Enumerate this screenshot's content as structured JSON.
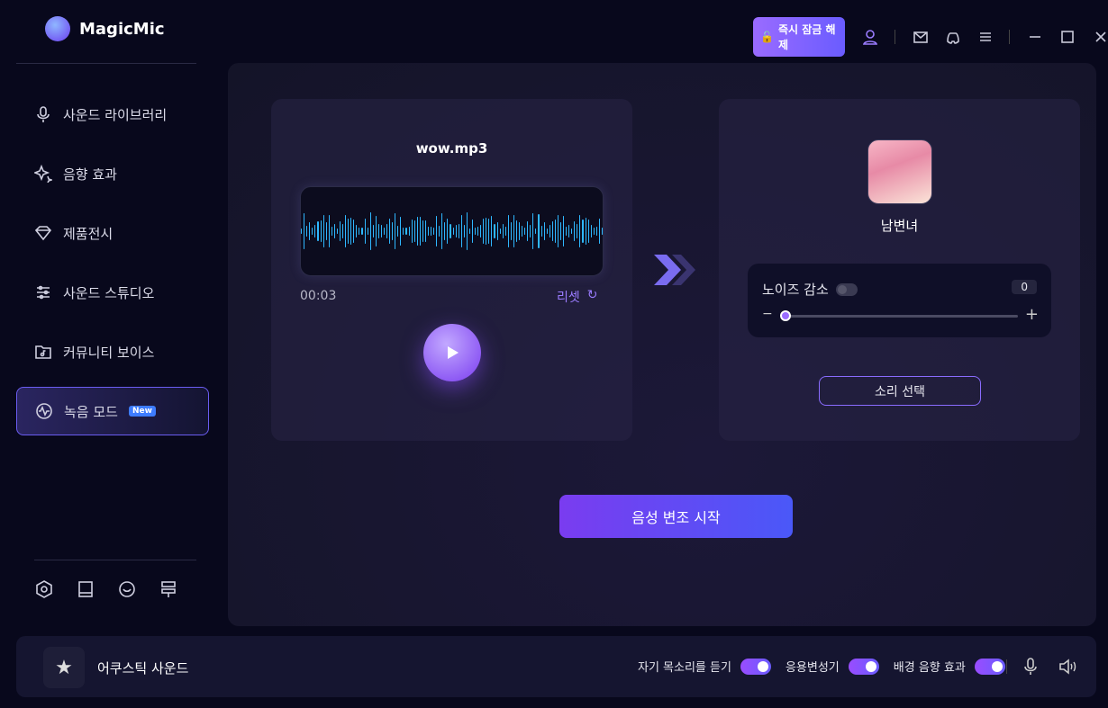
{
  "app": {
    "title": "MagicMic"
  },
  "topbar": {
    "unlock_label": "즉시 잠금 해제"
  },
  "sidebar": {
    "items": [
      {
        "label": "사운드 라이브러리",
        "icon": "microphone-icon"
      },
      {
        "label": "음향 효과",
        "icon": "sparkle-icon"
      },
      {
        "label": "제품전시",
        "icon": "diamond-icon"
      },
      {
        "label": "사운드 스튜디오",
        "icon": "sliders-icon"
      },
      {
        "label": "커뮤니티 보이스",
        "icon": "music-folder-icon"
      },
      {
        "label": "녹음 모드",
        "icon": "waveform-icon",
        "badge": "New",
        "active": true
      }
    ]
  },
  "player": {
    "filename": "wow.mp3",
    "time": "00:03",
    "reset_label": "리셋"
  },
  "voice": {
    "name": "남변녀",
    "noise_label": "노이즈 감소",
    "noise_enabled": false,
    "noise_value": "0",
    "select_label": "소리 선택"
  },
  "main": {
    "start_label": "음성 변조 시작"
  },
  "bottom": {
    "current_sound": "어쿠스틱 사운드",
    "toggles": [
      {
        "label": "자기 목소리를 듣기",
        "on": true
      },
      {
        "label": "응용변성기",
        "on": true
      },
      {
        "label": "배경 음향 효과",
        "on": true
      }
    ]
  },
  "colors": {
    "accent": "#7a3cf0",
    "wave": "#2fb8ff"
  }
}
